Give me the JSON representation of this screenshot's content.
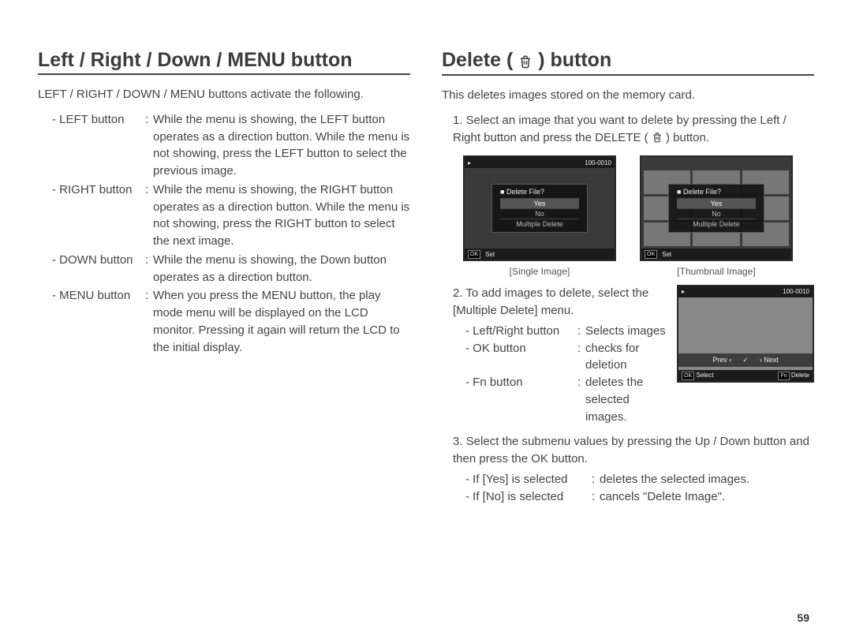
{
  "page_number": "59",
  "left": {
    "heading": "Left / Right / Down / MENU button",
    "intro": "LEFT / RIGHT / DOWN / MENU buttons activate the following.",
    "items": [
      {
        "label": "- LEFT button",
        "body": "While the menu is showing, the LEFT button operates as a direction button. While the menu is not showing, press the LEFT button to select the previous image."
      },
      {
        "label": "- RIGHT button",
        "body": "While the menu is showing, the RIGHT button operates as a direction button. While the menu is not showing, press the RIGHT button to select the next image."
      },
      {
        "label": "- DOWN button",
        "body": "While the menu is showing, the Down button operates as a direction button."
      },
      {
        "label": "- MENU button",
        "body": "When you press the MENU button, the play mode menu will be displayed on the LCD monitor. Pressing it again will return the LCD to the initial display."
      }
    ]
  },
  "right": {
    "heading_pre": "Delete (",
    "heading_post": ") button",
    "intro": "This deletes images stored on the memory card.",
    "step1_text": "1. Select an image that you want to delete by pressing the Left / Right button and press the DELETE (",
    "step1_text_tail": ") button.",
    "lcd_pair": [
      {
        "caption": "[Single Image]"
      },
      {
        "caption": "[Thumbnail Image]"
      }
    ],
    "lcd_dialog": {
      "title": "Delete File?",
      "options": [
        "Yes",
        "No",
        "Multiple Delete"
      ],
      "bottom_ok": "OK",
      "bottom_set": "Set"
    },
    "lcd_top_counter": "100-0010",
    "step2_text": "2. To add images to delete, select the [Multiple Delete] menu.",
    "step2_subs": [
      {
        "label": "- Left/Right button",
        "body": "Selects images"
      },
      {
        "label": "- OK button",
        "body": "checks for deletion"
      },
      {
        "label": "- Fn button",
        "body": "deletes the selected images."
      }
    ],
    "lcd_small": {
      "top_counter": "100-0010",
      "nav_prev": "Prev",
      "nav_next": "Next",
      "bottom_left_key": "OK",
      "bottom_left_label": "Select",
      "bottom_right_key": "Fn",
      "bottom_right_label": "Delete"
    },
    "step3_text": "3. Select the submenu values by pressing the Up / Down button and then press the OK button.",
    "step3_subs": [
      {
        "label": "- If [Yes] is selected",
        "body": "deletes the selected images."
      },
      {
        "label": "- If [No] is selected",
        "body": "cancels \"Delete Image\"."
      }
    ]
  }
}
